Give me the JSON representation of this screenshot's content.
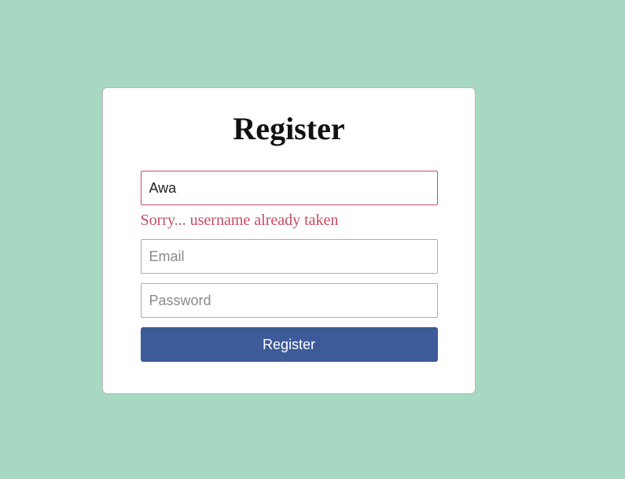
{
  "form": {
    "title": "Register",
    "username": {
      "value": "Awa",
      "error": "Sorry... username already taken"
    },
    "email": {
      "placeholder": "Email",
      "value": ""
    },
    "password": {
      "placeholder": "Password",
      "value": ""
    },
    "submit_label": "Register"
  }
}
